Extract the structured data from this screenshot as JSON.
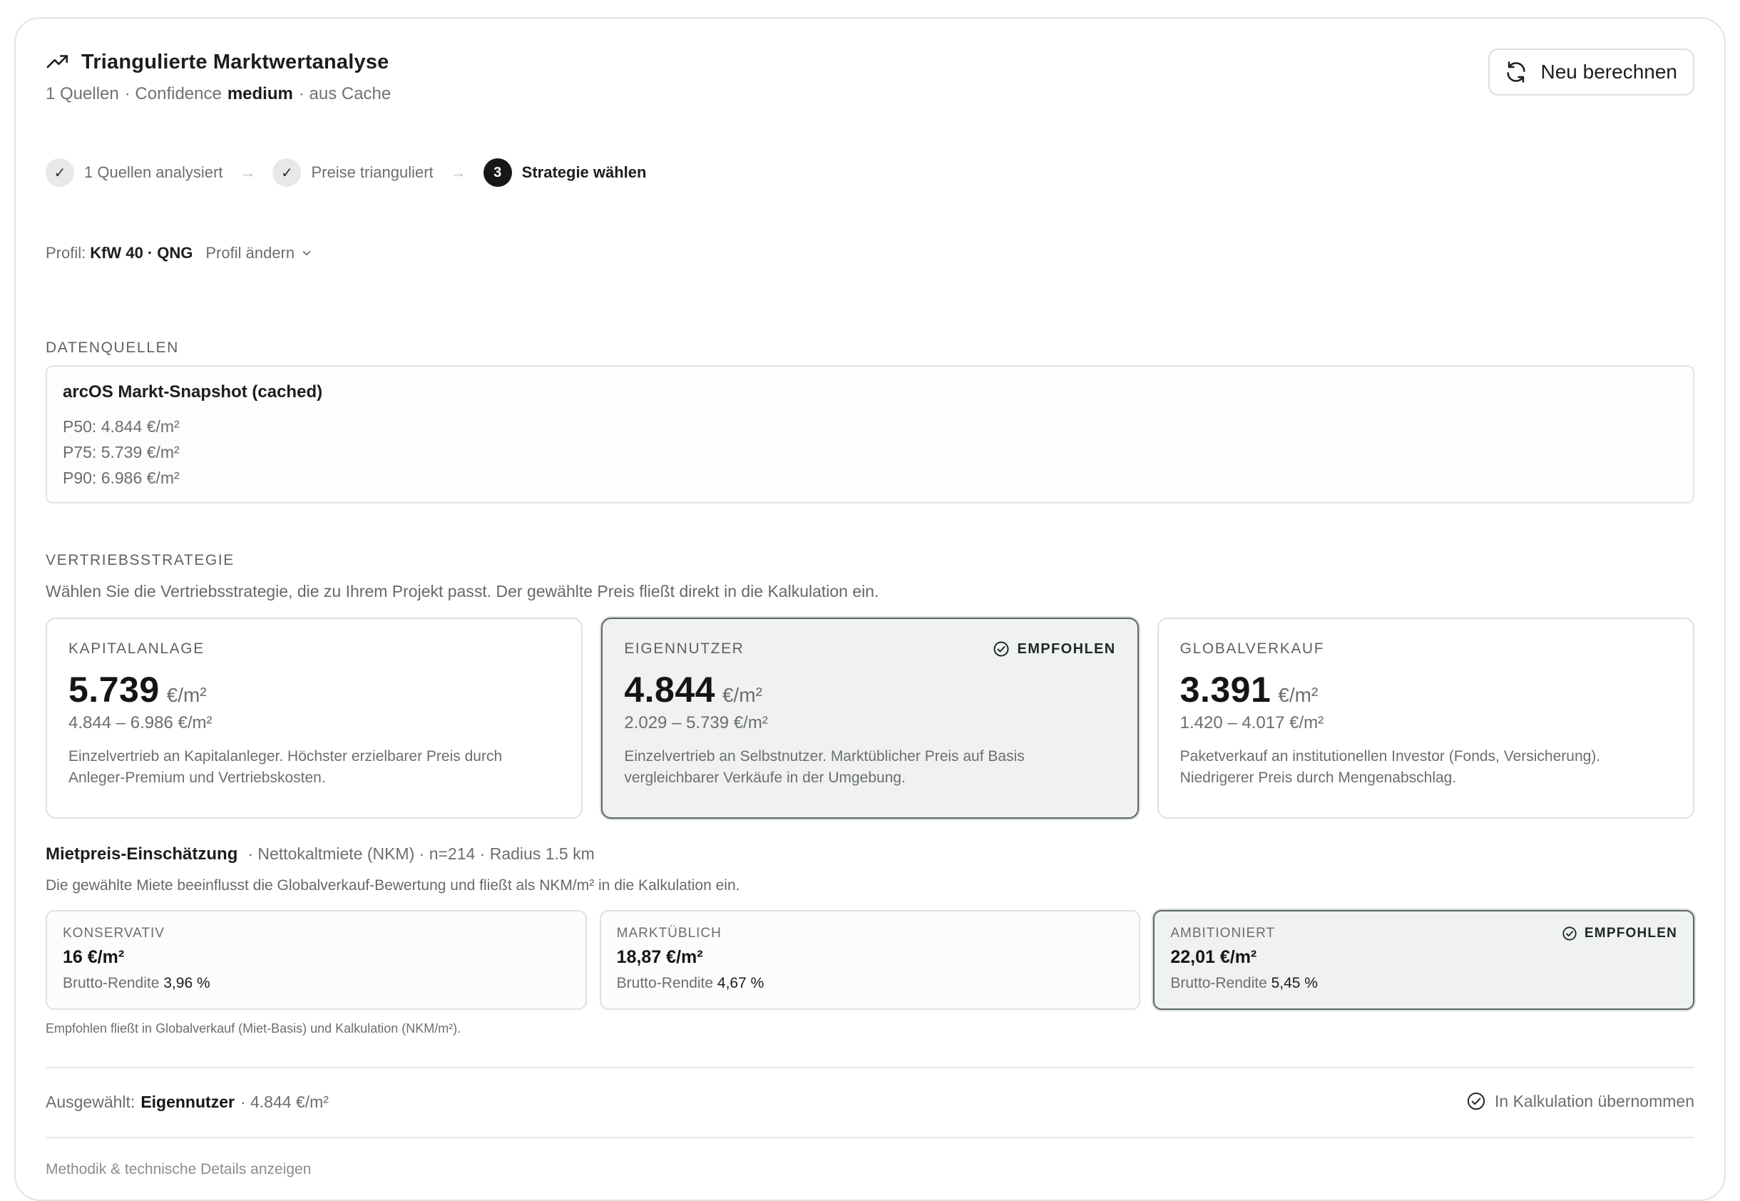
{
  "header": {
    "title": "Triangulierte Marktwertanalyse",
    "sources_count": "1 Quellen",
    "confidence_label": "· Confidence",
    "confidence_value": "medium",
    "cache_note": "· aus Cache",
    "recalc_label": "Neu berechnen"
  },
  "stepper": {
    "steps": [
      {
        "marker": "✓",
        "label": "1 Quellen analysiert"
      },
      {
        "marker": "✓",
        "label": "Preise trianguliert"
      },
      {
        "marker": "3",
        "label": "Strategie wählen"
      }
    ],
    "arrow": "→"
  },
  "profile": {
    "label": "Profil:",
    "energy": "KfW 40",
    "cert": "· QNG",
    "change_label": "Profil ändern"
  },
  "sources": {
    "section_label": "DATENQUELLEN",
    "items": [
      {
        "title": "arcOS Markt-Snapshot (cached)",
        "lines": [
          "P50: 4.844 €/m²",
          "P75: 5.739 €/m²",
          "P90: 6.986 €/m²"
        ]
      }
    ]
  },
  "strategy": {
    "section_label": "VERTRIEBSSTRATEGIE",
    "description": "Wählen Sie die Vertriebsstrategie, die zu Ihrem Projekt passt. Der gewählte Preis fließt direkt in die Kalkulation ein.",
    "recommended_label": "EMPFOHLEN",
    "cards": [
      {
        "name": "KAPITALANLAGE",
        "price": "5.739",
        "unit": "€/m²",
        "range": "4.844 – 6.986 €/m²",
        "desc": "Einzelvertrieb an Kapitalanleger. Höchster erzielbarer Preis durch Anleger-Premium und Vertriebskosten."
      },
      {
        "name": "EIGENNUTZER",
        "price": "4.844",
        "unit": "€/m²",
        "range": "2.029 – 5.739 €/m²",
        "desc": "Einzelvertrieb an Selbstnutzer. Marktüblicher Preis auf Basis vergleichbarer Verkäufe in der Umgebung."
      },
      {
        "name": "GLOBALVERKAUF",
        "price": "3.391",
        "unit": "€/m²",
        "range": "1.420 – 4.017 €/m²",
        "desc": "Paketverkauf an institutionellen Investor (Fonds, Versicherung). Niedrigerer Preis durch Mengenabschlag."
      }
    ]
  },
  "rent": {
    "title": "Mietpreis-Einschätzung",
    "meta": "· Nettokaltmiete (NKM) · n=214 · Radius 1.5 km",
    "description": "Die gewählte Miete beeinflusst die Globalverkauf-Bewertung und fließt als NKM/m² in die Kalkulation ein.",
    "yield_label": "Brutto-Rendite",
    "recommended_label": "EMPFOHLEN",
    "options": [
      {
        "name": "KONSERVATIV",
        "value": "16 €/m²",
        "yield": "3,96 %"
      },
      {
        "name": "MARKTÜBLICH",
        "value": "18,87 €/m²",
        "yield": "4,67 %"
      },
      {
        "name": "AMBITIONIERT",
        "value": "22,01 €/m²",
        "yield": "5,45 %"
      }
    ],
    "note": "Empfohlen fließt in Globalverkauf (Miet-Basis) und Kalkulation (NKM/m²)."
  },
  "footer": {
    "selected_label": "Ausgewählt:",
    "selected_value": "Eigennutzer",
    "selected_price": "· 4.844 €/m²",
    "applied_label": "In Kalkulation übernommen",
    "method_link": "Methodik & technische Details anzeigen"
  }
}
